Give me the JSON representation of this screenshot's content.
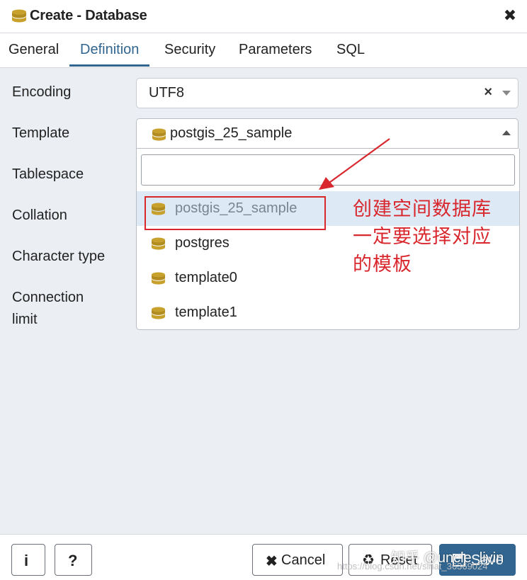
{
  "window": {
    "title": "Create - Database",
    "title_icon": "database-icon",
    "close_label": "✖"
  },
  "tabs": [
    {
      "label": "General",
      "active": false
    },
    {
      "label": "Definition",
      "active": true
    },
    {
      "label": "Security",
      "active": false
    },
    {
      "label": "Parameters",
      "active": false
    },
    {
      "label": "SQL",
      "active": false
    }
  ],
  "form": {
    "labels": {
      "encoding": "Encoding",
      "template": "Template",
      "tablespace": "Tablespace",
      "collation": "Collation",
      "character_type": "Character type",
      "connection_limit_1": "Connection",
      "connection_limit_2": "limit"
    },
    "encoding_value": "UTF8",
    "template_value": "postgis_25_sample",
    "clear_glyph": "×"
  },
  "dropdown": {
    "search_value": "",
    "options": [
      {
        "label": "postgis_25_sample",
        "highlighted": true
      },
      {
        "label": "postgres",
        "highlighted": false
      },
      {
        "label": "template0",
        "highlighted": false
      },
      {
        "label": "template1",
        "highlighted": false
      }
    ]
  },
  "annotation": {
    "lines": [
      "创建空间数据库",
      "一定要选择对应",
      "的模板"
    ],
    "color": "#d9272e"
  },
  "footer": {
    "info_label": "i",
    "help_label": "?",
    "cancel_icon": "✖",
    "cancel_label": "Cancel",
    "reset_icon": "♻",
    "reset_label": "Reset",
    "save_label": "Save"
  },
  "watermark": {
    "text": "知乎 @uncle_liyin",
    "url": "https://blog.csdn.net/sinat_36369024"
  },
  "colors": {
    "accent": "#326690",
    "highlight": "#dde9f5",
    "db_icon": "#c8a02c"
  }
}
